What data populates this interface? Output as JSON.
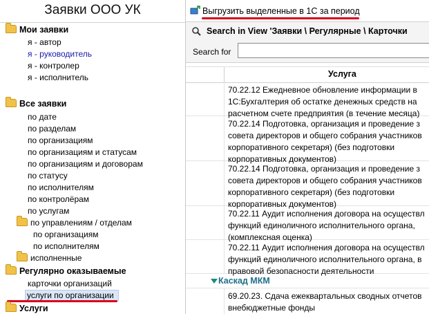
{
  "sidebar": {
    "title": "Заявки ООО УК",
    "my_requests": {
      "label": "Мои заявки",
      "items": [
        "я - автор",
        "я - руководитель",
        "я - контролер",
        "я - исполнитель"
      ]
    },
    "all_requests": {
      "label": "Все заявки",
      "items": [
        "по дате",
        "по разделам",
        "по организациям",
        "по организациям и статусам",
        "по организациям и договорам",
        "по статусу",
        "по исполнителям",
        "по контролёрам",
        "по услугам"
      ],
      "subfolder": {
        "label": "по управлениям / отделам",
        "items": [
          "по организациям",
          "по исполнителям"
        ]
      },
      "done": "исполненные"
    },
    "regular": {
      "label": "Регулярно оказываемые",
      "items": [
        "карточки организаций",
        "услуги по организации"
      ]
    },
    "services": {
      "label": "Услуги"
    }
  },
  "toolbar": {
    "export_label": "Выгрузить выделенные в 1С за период"
  },
  "search": {
    "title": "Search in View 'Заявки \\ Регулярные \\ Карточки",
    "label": "Search for",
    "value": ""
  },
  "table": {
    "column": "Услуга",
    "rows": [
      "70.22.12 Ежедневное обновление информации в\n1С:Бухгалтерия об остатке денежных средств на\nрасчетном счете предприятия (в течение месяца)",
      "70.22.14 Подготовка, организация и проведение з\nсовета директоров и общего собрания участников\nкорпоративного секретаря) (без подготовки\nкорпоративных документов)",
      "70.22.14 Подготовка, организация и проведение з\nсовета директоров и общего собрания участников\nкорпоративного секретаря) (без подготовки\nкорпоративных документов)",
      "70.22.11 Аудит исполнения договора на осуществл\nфункций единоличного исполнительного органа,\n(комплексная оценка)",
      "70.22.11 Аудит исполнения договора на осуществл\nфункций единоличного исполнительного органа, в\nправовой безопасности деятельности"
    ],
    "group": "Каскад МКМ",
    "group_rows": [
      "69.20.23. Сдача ежеквартальных сводных отчетов\nвнебюджетные фонды"
    ]
  }
}
